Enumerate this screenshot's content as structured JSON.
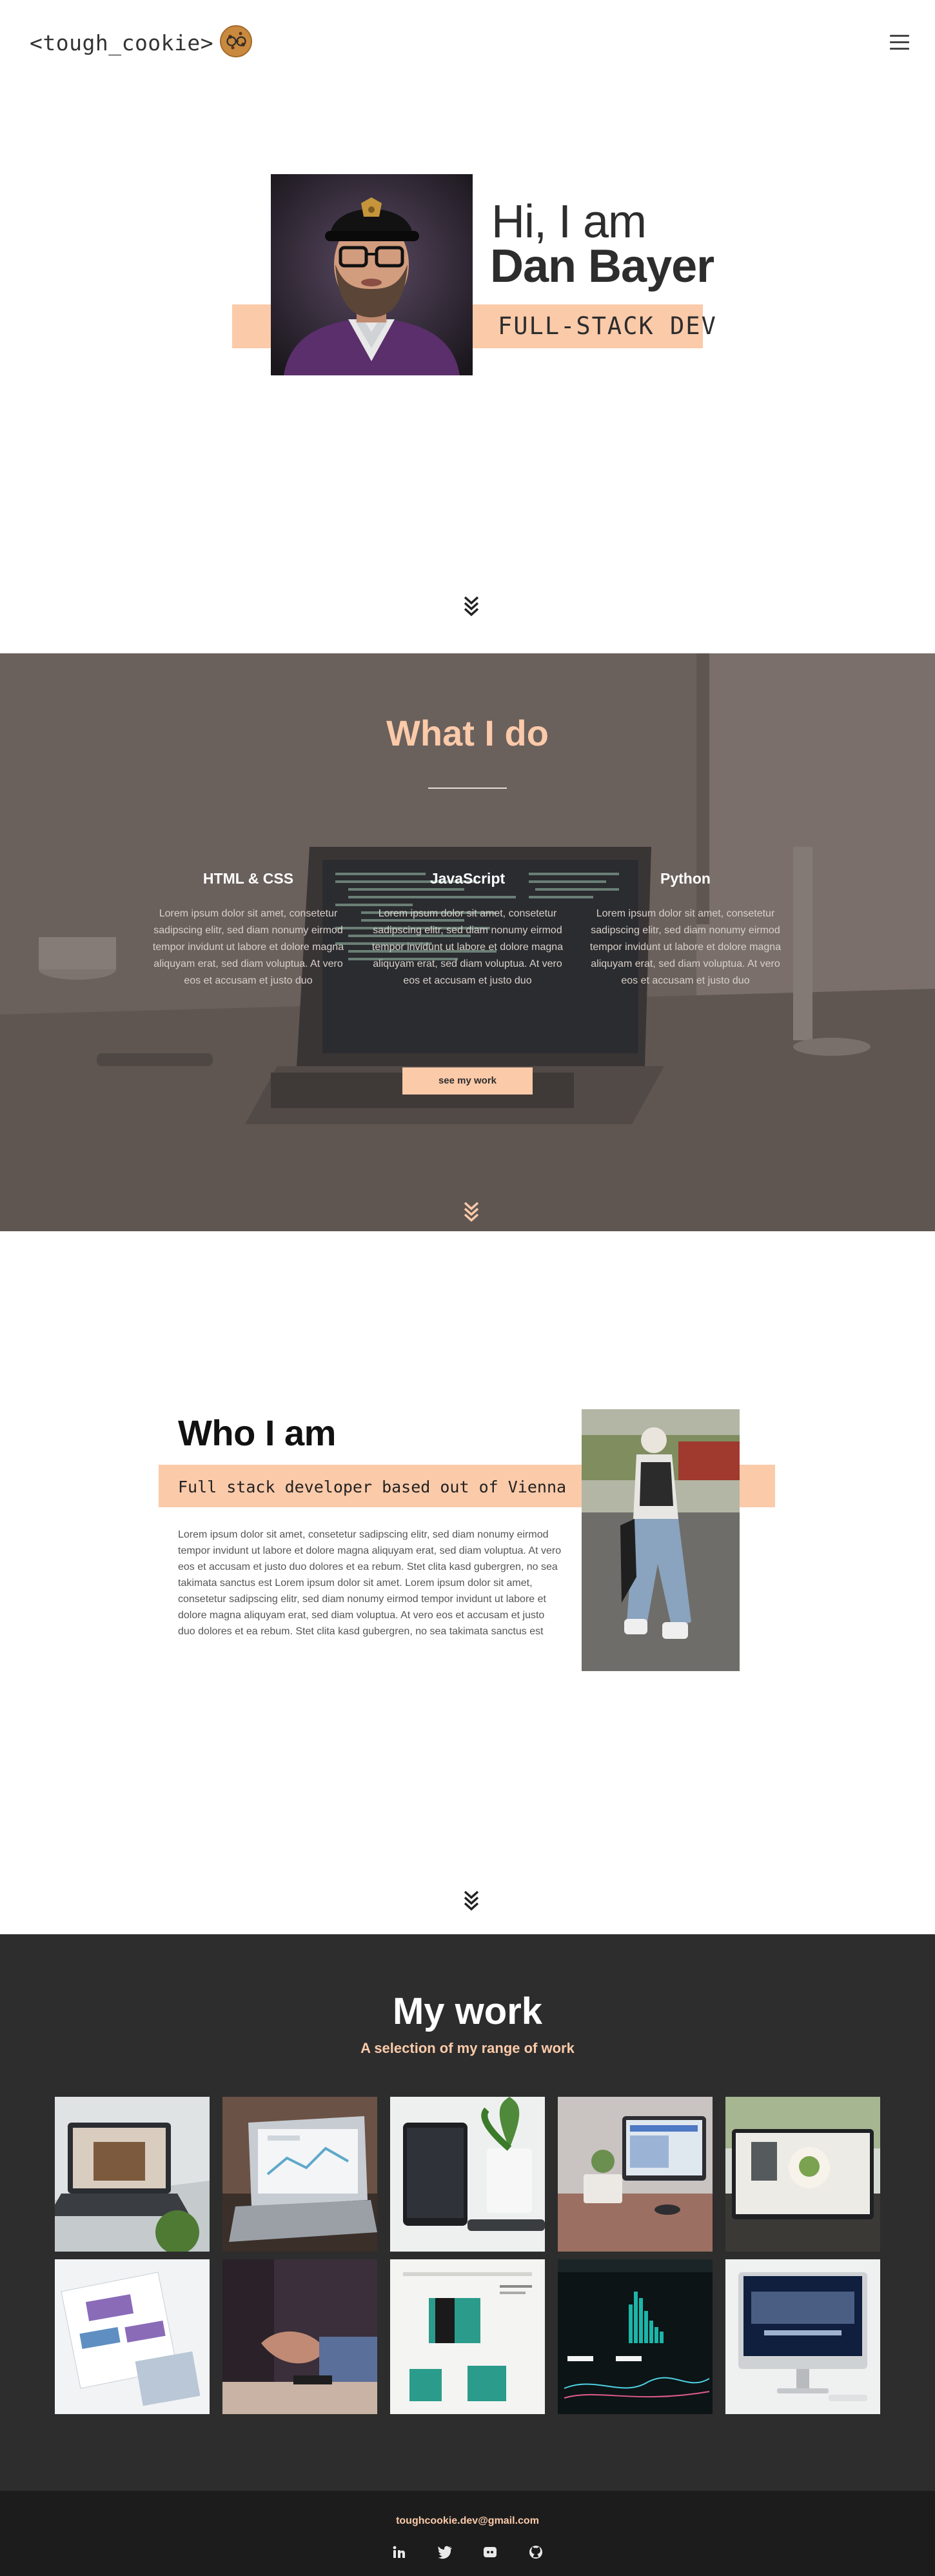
{
  "header": {
    "logo_text": "<tough_cookie>",
    "logo_icon": "cookie-icon",
    "menu_icon": "hamburger-menu-icon"
  },
  "hero": {
    "greeting": "Hi, I am",
    "name": "Dan Bayer",
    "role": "FULL-STACK DEV"
  },
  "what_i_do": {
    "title": "What I do",
    "skills": [
      {
        "title": "HTML & CSS",
        "text": "Lorem ipsum dolor sit amet, consetetur sadipscing elitr, sed diam nonumy eirmod tempor invidunt ut labore et dolore magna aliquyam erat, sed diam voluptua. At vero eos et accusam et justo duo"
      },
      {
        "title": "JavaScript",
        "text": "Lorem ipsum dolor sit amet, consetetur sadipscing elitr, sed diam nonumy eirmod tempor invidunt ut labore et dolore magna aliquyam erat, sed diam voluptua. At vero eos et accusam et justo duo"
      },
      {
        "title": "Python",
        "text": "Lorem ipsum dolor sit amet, consetetur sadipscing elitr, sed diam nonumy eirmod tempor invidunt ut labore et dolore magna aliquyam erat, sed diam voluptua. At vero eos et accusam et justo duo"
      }
    ],
    "button_label": "see my work"
  },
  "who_i_am": {
    "title": "Who I am",
    "tagline": "Full stack developer based out of Vienna",
    "text": "Lorem ipsum dolor sit amet, consetetur sadipscing elitr, sed diam nonumy eirmod tempor invidunt ut labore et dolore magna aliquyam erat, sed diam voluptua. At vero eos et accusam et justo duo dolores et ea rebum. Stet clita kasd gubergren, no sea takimata sanctus est Lorem ipsum dolor sit amet. Lorem ipsum dolor sit amet, consetetur sadipscing elitr, sed diam nonumy eirmod tempor invidunt ut labore et dolore magna aliquyam erat, sed diam voluptua. At vero eos et accusam et justo duo dolores et ea rebum. Stet clita kasd gubergren, no sea takimata sanctus est"
  },
  "my_work": {
    "title": "My work",
    "subtitle": "A selection of my range of work"
  },
  "footer": {
    "email": "toughcookie.dev@gmail.com",
    "social_icons": [
      "linkedin-icon",
      "twitter-icon",
      "discord-icon",
      "github-icon"
    ]
  },
  "colors": {
    "accent": "#fbcaa9",
    "dark": "#2d2d2d",
    "footer": "#1c1c1c",
    "text": "#2d2d2d"
  }
}
